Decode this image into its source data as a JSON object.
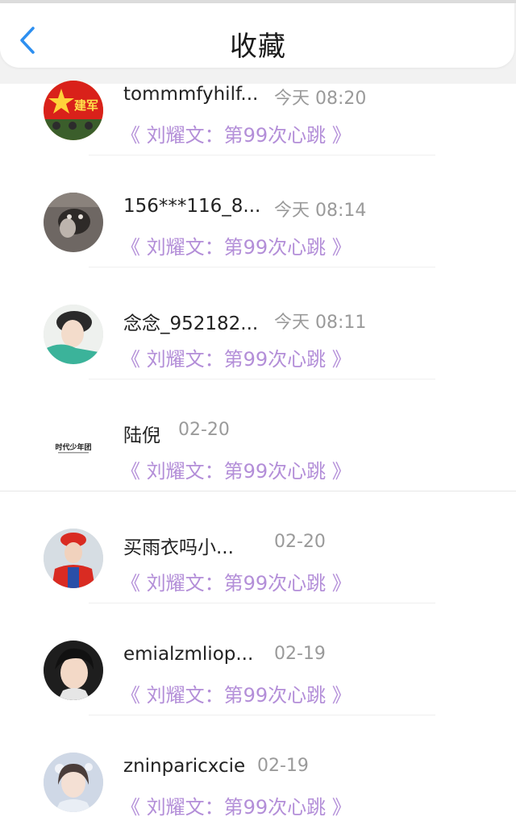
{
  "header": {
    "title": "收藏"
  },
  "items": [
    {
      "name": "tommmfyhilf...",
      "time": "今天 08:20",
      "subtitle": "《 刘耀文：第99次心跳 》",
      "avatar": "avatar-army-day-badge"
    },
    {
      "name": "156***116_8...",
      "time": "今天 08:14",
      "subtitle": "《 刘耀文：第99次心跳 》",
      "avatar": "avatar-cat-photo"
    },
    {
      "name": "念念_952182...",
      "time": "今天 08:11",
      "subtitle": "《 刘耀文：第99次心跳 》",
      "avatar": "avatar-boy-photo"
    },
    {
      "name": "陆倪",
      "time": "02-20",
      "subtitle": "《 刘耀文：第99次心跳 》",
      "avatar": "avatar-logo-text",
      "avatar_text": "时代少年团"
    },
    {
      "name": "买雨衣吗小...",
      "time": "02-20",
      "subtitle": "《 刘耀文：第99次心跳 》",
      "avatar": "avatar-mario-cosplay"
    },
    {
      "name": "emialzmliop...",
      "time": "02-19",
      "subtitle": "《 刘耀文：第99次心跳 》",
      "avatar": "avatar-child-photo"
    },
    {
      "name": "zninparicxcie",
      "time": "02-19",
      "subtitle": "《 刘耀文：第99次心跳 》",
      "avatar": "avatar-girl-photo"
    }
  ]
}
